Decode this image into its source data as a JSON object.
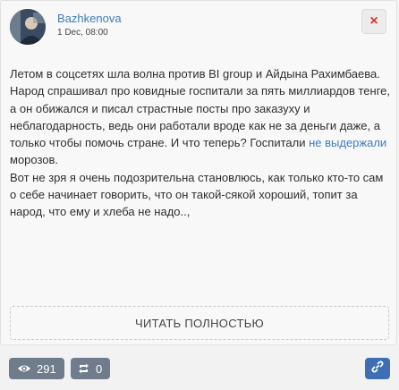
{
  "post": {
    "author": "Bazhkenova",
    "date": "1 Dec, 08:00",
    "close_label": "×",
    "text": {
      "p1_before_link": "Летом в соцсетях шла волна против BI group и Айдына Рахимбаева. Народ спрашивал про ковидные госпитали за пять миллиардов тенге, а он обижался и писал страстные посты про заказуху и неблагодарность, ведь они работали вроде как не за деньги даже, а только чтобы помочь стране. И что теперь? Госпитали ",
      "link": "не выдержали",
      "p1_after_link": " морозов.",
      "p2": "Вот не зря я очень подозрительна становлюсь, как только кто-то сам о себе начинает говорить, что он такой-сякой хороший, топит за народ, что ему и хлеба не надо..,"
    },
    "read_more": "ЧИТАТЬ ПОЛНОСТЬЮ"
  },
  "footer": {
    "views": "291",
    "reposts": "0"
  },
  "icons": {
    "close": "close-icon",
    "views": "eye-icon",
    "reposts": "repost-icon",
    "link": "link-icon"
  },
  "colors": {
    "author": "#3d7dbf",
    "link": "#3d7dbf",
    "close": "#dd3333",
    "pill": "#6f7c8b",
    "link_button": "#3e6fb5"
  }
}
